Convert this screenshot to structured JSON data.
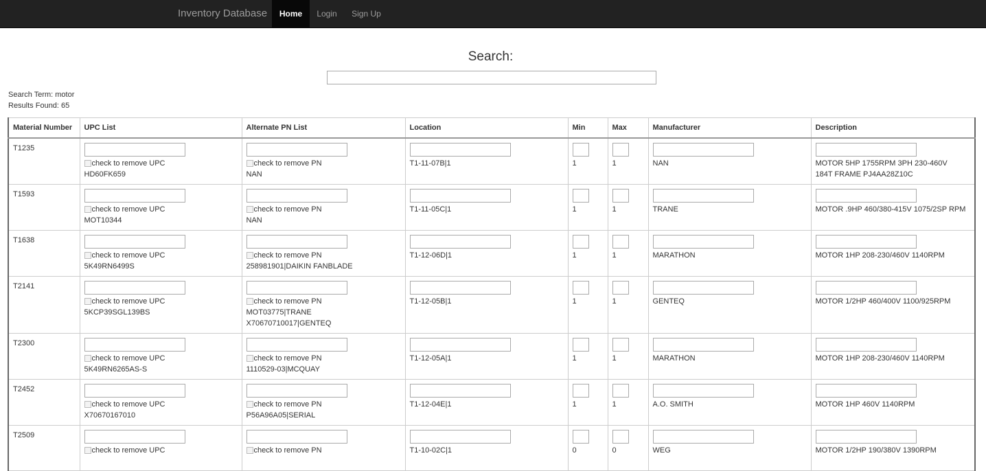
{
  "nav": {
    "brand": "Inventory Database",
    "home": "Home",
    "login": "Login",
    "signup": "Sign Up"
  },
  "search": {
    "title": "Search:",
    "value": "",
    "term": "Search Term: motor",
    "results": "Results Found: 65"
  },
  "table": {
    "headers": [
      "Material Number",
      "UPC List",
      "Alternate PN List",
      "Location",
      "Min",
      "Max",
      "Manufacturer",
      "Description"
    ],
    "upc_remove_label": "check to remove UPC",
    "pn_remove_label": "check to remove PN",
    "rows": [
      {
        "material": "T1235",
        "upc": "HD60FK659",
        "pn": [
          "NAN"
        ],
        "location": "T1-11-07B|1",
        "min": "1",
        "max": "1",
        "manufacturer": "NAN",
        "description": [
          "MOTOR 5HP 1755RPM 3PH 230-460V",
          "184T FRAME PJ4AA28Z10C"
        ]
      },
      {
        "material": "T1593",
        "upc": "MOT10344",
        "pn": [
          "NAN"
        ],
        "location": "T1-11-05C|1",
        "min": "1",
        "max": "1",
        "manufacturer": "TRANE",
        "description": [
          "MOTOR .9HP 460/380-415V 1075/2SP RPM"
        ]
      },
      {
        "material": "T1638",
        "upc": "5K49RN6499S",
        "pn": [
          "258981901|DAIKIN FANBLADE"
        ],
        "location": "T1-12-06D|1",
        "min": "1",
        "max": "1",
        "manufacturer": "MARATHON",
        "description": [
          "MOTOR 1HP 208-230/460V 1140RPM"
        ]
      },
      {
        "material": "T2141",
        "upc": "5KCP39SGL139BS",
        "pn": [
          "MOT03775|TRANE",
          "X70670710017|GENTEQ"
        ],
        "location": "T1-12-05B|1",
        "min": "1",
        "max": "1",
        "manufacturer": "GENTEQ",
        "description": [
          "MOTOR 1/2HP 460/400V 1100/925RPM"
        ]
      },
      {
        "material": "T2300",
        "upc": "5K49RN6265AS-S",
        "pn": [
          "1110529-03|MCQUAY"
        ],
        "location": "T1-12-05A|1",
        "min": "1",
        "max": "1",
        "manufacturer": "MARATHON",
        "description": [
          "MOTOR 1HP 208-230/460V 1140RPM"
        ]
      },
      {
        "material": "T2452",
        "upc": "X70670167010",
        "pn": [
          "P56A96A05|SERIAL"
        ],
        "location": "T1-12-04E|1",
        "min": "1",
        "max": "1",
        "manufacturer": "A.O. SMITH",
        "description": [
          "MOTOR 1HP 460V 1140RPM"
        ]
      },
      {
        "material": "T2509",
        "upc": "",
        "pn": [
          ""
        ],
        "location": "T1-10-02C|1",
        "min": "0",
        "max": "0",
        "manufacturer": "WEG",
        "description": [
          "MOTOR 1/2HP 190/380V 1390RPM"
        ]
      }
    ]
  }
}
